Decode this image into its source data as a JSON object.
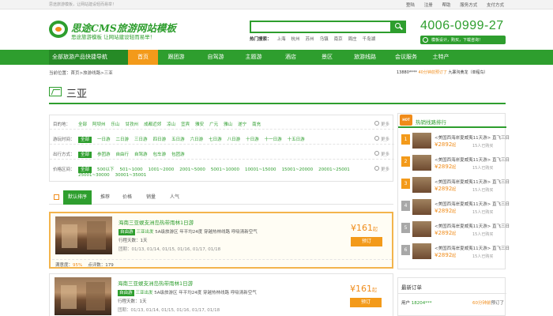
{
  "topbar": {
    "welcome": "思途旅游模板，让网站建设轻而易举！",
    "links": [
      "登陆",
      "注册",
      "帮助",
      "服务方式",
      "支付方式"
    ]
  },
  "header": {
    "logo_title": "思途CMS旅游网站模板",
    "logo_sub": "思途旅游模板 让网站建设轻而易举！",
    "search_placeholder": "",
    "hot_label": "热门搜索：",
    "hot_cities": [
      "上海",
      "杭州",
      "苏州",
      "乌镇",
      "南京",
      "周庄",
      "千岛湖"
    ],
    "phone": "4006-0999-27",
    "phone_sub": "模板设计，购买，下载咨询！"
  },
  "nav": {
    "items": [
      "全部旅游产品快捷导航",
      "首页",
      "跟团游",
      "自驾游",
      "主题游",
      "酒店",
      "景区",
      "旅游线路",
      "会议服务",
      "土特产"
    ],
    "active_index": 1
  },
  "breadcrumb": {
    "label": "当前位置：",
    "items": [
      "首页",
      "旅游线路",
      "三亚"
    ],
    "sep": ">"
  },
  "ticker": {
    "user": "13880****",
    "time": "40分钟前",
    "action": "预订了",
    "product": "九寨沟黄龙（单程鸟）"
  },
  "page": {
    "title": "三亚"
  },
  "filters": {
    "more": "更多",
    "rows": [
      {
        "key": "目的地：",
        "options": [
          "全部",
          "阿坝州",
          "乐山",
          "甘孜州",
          "成都近郊",
          "凉山",
          "宜宾",
          "雅安",
          "广元",
          "雅山",
          "遂宁",
          "南充"
        ],
        "selected": -1
      },
      {
        "key": "游玩时间：",
        "options": [
          "全部",
          "一日游",
          "二日游",
          "三日游",
          "四日游",
          "五日游",
          "六日游",
          "七日游",
          "八日游",
          "十日游",
          "十一日游",
          "十五日游"
        ],
        "selected": 0
      },
      {
        "key": "出行方式：",
        "options": [
          "全部",
          "参团游",
          "自由行",
          "自驾游",
          "包车游",
          "包团游"
        ],
        "selected": 0
      },
      {
        "key": "价格区间：",
        "options": [
          "全部",
          "500以下",
          "501~1000",
          "1001~2000",
          "2001~5000",
          "5001~10000",
          "10001~15000",
          "15001~20000",
          "20001~25001",
          "25001~30000",
          "30001~35001"
        ],
        "selected": 0
      }
    ]
  },
  "sort_tabs": [
    "默认排序",
    "推荐",
    "价格",
    "销量",
    "人气"
  ],
  "products": [
    {
      "title": "海南三亚蜈支洲岛热带雨林1日游",
      "badge": "自由游",
      "depart": "三亚出发",
      "tag": "5A级旅游区",
      "desc": "年平均24度 穿越热林线路 呼吸清新空气",
      "days": "行程天数：1天",
      "dates": "团期：01/13, 01/14, 01/15, 01/16, 01/17, 01/18",
      "satisfaction_label": "满意度：",
      "satisfaction": "95%",
      "reviews_label": "点评数：",
      "reviews": "179",
      "price": "¥161",
      "price_unit": "起",
      "book": "预订"
    },
    {
      "title": "海南三亚蜈支洲岛热带雨林1日游",
      "badge": "自由游",
      "depart": "三亚出发",
      "tag": "5A级旅游区",
      "desc": "年平均24度 穿越热林线路 呼吸清新空气",
      "days": "行程天数：1天",
      "dates": "团期：01/13, 01/14, 01/15, 01/16, 01/17, 01/18",
      "price": "¥161",
      "price_unit": "起",
      "book": "预订"
    }
  ],
  "sidebar": {
    "hot_badge": "HOT",
    "title": "热销线路排行",
    "ranks": [
      {
        "num": "1",
        "title": "<美国西海岸夏威夷11天游> 直飞三日",
        "price": "¥2892",
        "price_unit": "起",
        "bought": "15人已购买"
      },
      {
        "num": "2",
        "title": "<美国西海岸夏威夷11天游> 直飞三日",
        "price": "¥2892",
        "price_unit": "起",
        "bought": "15人已购买"
      },
      {
        "num": "3",
        "title": "<美国西海岸夏威夷11天游> 直飞三日",
        "price": "¥2892",
        "price_unit": "起",
        "bought": "15人已购买"
      },
      {
        "num": "4",
        "title": "<美国西海岸夏威夷11天游> 直飞三日",
        "price": "¥2892",
        "price_unit": "起",
        "bought": "15人已购买"
      },
      {
        "num": "5",
        "title": "<美国西海岸夏威夷11天游> 直飞三日",
        "price": "¥2892",
        "price_unit": "起",
        "bought": "15人已购买"
      },
      {
        "num": "6",
        "title": "<美国西海岸夏威夷11天游> 直飞三日",
        "price": "¥2892",
        "price_unit": "起",
        "bought": "15人已购买"
      }
    ]
  },
  "orders": {
    "title": "最新订单",
    "row": {
      "user": "用户",
      "name": "18204***",
      "time": "60分钟前",
      "action": "预订了"
    }
  },
  "colors": {
    "brand": "#2e9e2e",
    "accent": "#f39a1a",
    "price": "#f08c1a"
  }
}
